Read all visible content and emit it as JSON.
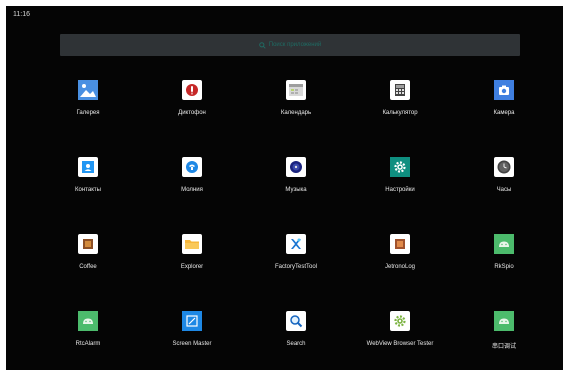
{
  "status_bar": {
    "time": "11:16"
  },
  "search": {
    "placeholder": "Поиск приложений"
  },
  "apps": [
    {
      "label": "Галерея",
      "icon": "gallery-icon",
      "color": "#4a90e2"
    },
    {
      "label": "Диктофон",
      "icon": "dictaphone-icon",
      "color": "#ffffff"
    },
    {
      "label": "Календарь",
      "icon": "calendar-icon",
      "color": "#ffffff"
    },
    {
      "label": "Калькулятор",
      "icon": "calculator-icon",
      "color": "#ffffff"
    },
    {
      "label": "Камера",
      "icon": "camera-icon",
      "color": "#3f7fe0"
    },
    {
      "label": "Контакты",
      "icon": "contacts-icon",
      "color": "#ffffff"
    },
    {
      "label": "Молния",
      "icon": "lightning-icon",
      "color": "#ffffff"
    },
    {
      "label": "Музыка",
      "icon": "music-icon",
      "color": "#ffffff"
    },
    {
      "label": "Настройки",
      "icon": "settings-icon",
      "color": "#0f8f80"
    },
    {
      "label": "Часы",
      "icon": "clock-icon",
      "color": "#ffffff"
    },
    {
      "label": "Coffee",
      "icon": "coffee-icon",
      "color": "#ffffff"
    },
    {
      "label": "Explorer",
      "icon": "explorer-icon",
      "color": "#ffffff"
    },
    {
      "label": "FactoryTestTool",
      "icon": "factory-test-icon",
      "color": "#ffffff"
    },
    {
      "label": "JetronoLog",
      "icon": "jetronolog-icon",
      "color": "#ffffff"
    },
    {
      "label": "RkSpio",
      "icon": "android-icon",
      "color": "#4cbb6c"
    },
    {
      "label": "RtcAlarm",
      "icon": "android-icon",
      "color": "#4cbb6c"
    },
    {
      "label": "Screen Master",
      "icon": "screen-master-icon",
      "color": "#1e88e5"
    },
    {
      "label": "Search",
      "icon": "search-icon",
      "color": "#ffffff"
    },
    {
      "label": "WebView Browser Tester",
      "icon": "webview-icon",
      "color": "#ffffff"
    },
    {
      "label": "串口调试",
      "icon": "android-icon",
      "color": "#4cbb6c"
    }
  ]
}
